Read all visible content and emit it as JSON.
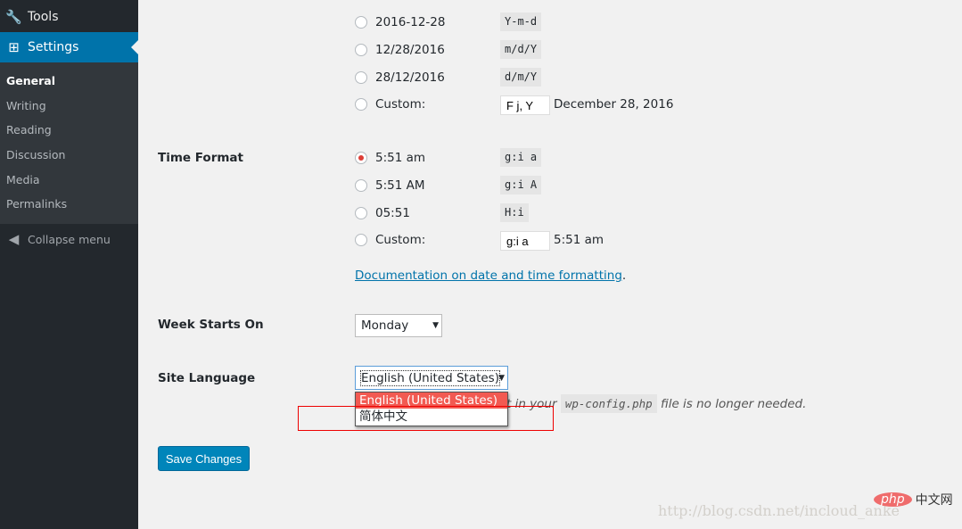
{
  "sidebar": {
    "tools": "Tools",
    "settings": "Settings",
    "submenu": [
      "General",
      "Writing",
      "Reading",
      "Discussion",
      "Media",
      "Permalinks"
    ],
    "collapse": "Collapse menu"
  },
  "date_format": {
    "options": [
      {
        "label": "2016-12-28",
        "code": "Y-m-d"
      },
      {
        "label": "12/28/2016",
        "code": "m/d/Y"
      },
      {
        "label": "28/12/2016",
        "code": "d/m/Y"
      }
    ],
    "custom_label": "Custom:",
    "custom_value": "F j, Y",
    "custom_preview": "December 28, 2016"
  },
  "time_format": {
    "label": "Time Format",
    "options": [
      {
        "label": "5:51 am",
        "code": "g:i a",
        "selected": true
      },
      {
        "label": "5:51 AM",
        "code": "g:i A"
      },
      {
        "label": "05:51",
        "code": "H:i"
      }
    ],
    "custom_label": "Custom:",
    "custom_value": "g:i a",
    "custom_preview": "5:51 am",
    "doc_link": "Documentation on date and time formatting",
    "doc_suffix": "."
  },
  "week": {
    "label": "Week Starts On",
    "value": "Monday"
  },
  "language": {
    "label": "Site Language",
    "value": "English (United States)",
    "options": [
      "English (United States)",
      "简体中文"
    ],
    "desc_pre": "t in your",
    "desc_code": "wp-config.php",
    "desc_post": "file is no longer needed."
  },
  "save": "Save Changes",
  "watermark": "http://blog.csdn.net/incloud_anke",
  "logo": {
    "php": "php",
    "cn": "中文网"
  }
}
